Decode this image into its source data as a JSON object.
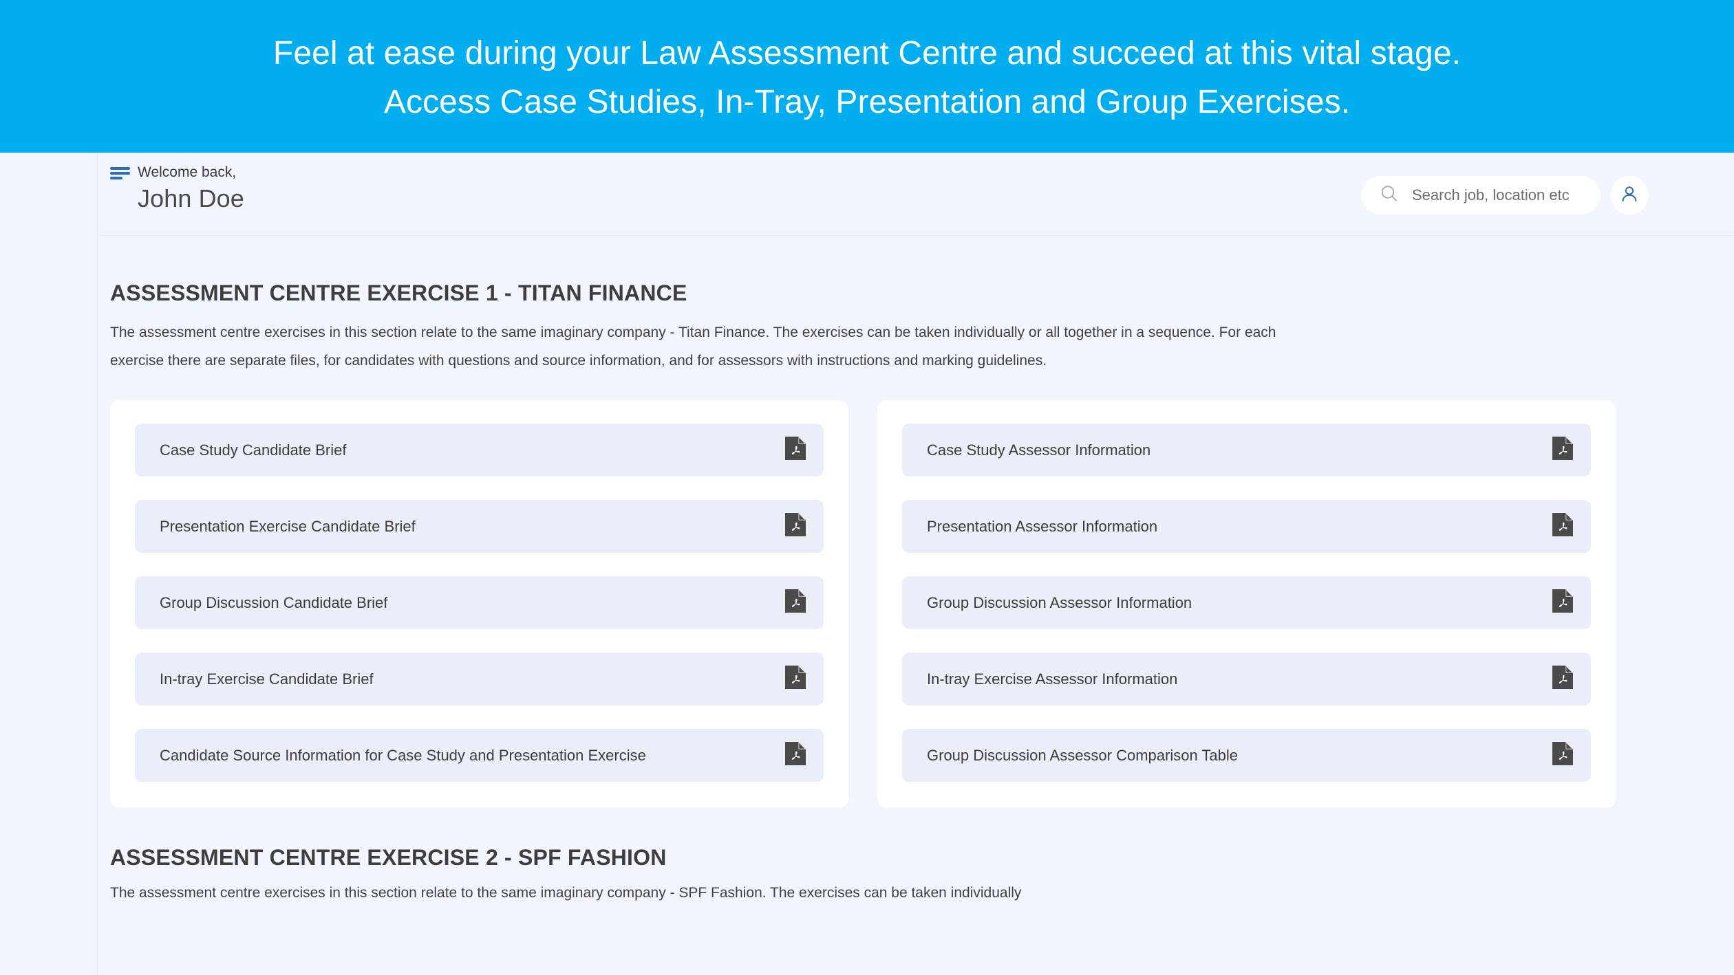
{
  "banner": {
    "line1": "Feel at ease during your Law Assessment Centre and succeed at this vital stage.",
    "line2": "Access Case Studies, In-Tray, Presentation and Group Exercises.",
    "background_color": "#00adef",
    "text_color": "#ffffff"
  },
  "header": {
    "menu_icon": "hamburger-icon",
    "welcome_label": "Welcome back,",
    "user_name": "John Doe",
    "search": {
      "icon": "search-icon",
      "placeholder": "Search job, location etc",
      "value": ""
    },
    "profile": {
      "icon": "user-icon"
    },
    "accent_color": "#2f6eb5"
  },
  "sections": [
    {
      "title": "ASSESSMENT CENTRE EXERCISE 1 - TITAN FINANCE",
      "description": "The assessment centre exercises in this section relate to the same imaginary company - Titan Finance. The exercises can be taken individually or all together in a sequence. For each exercise there are separate files, for candidates with questions and source information, and for assessors with instructions and marking guidelines.",
      "candidate_documents": [
        {
          "label": "Case Study Candidate Brief",
          "icon": "pdf-icon"
        },
        {
          "label": "Presentation Exercise Candidate Brief",
          "icon": "pdf-icon"
        },
        {
          "label": "Group Discussion Candidate Brief",
          "icon": "pdf-icon"
        },
        {
          "label": "In-tray Exercise Candidate Brief",
          "icon": "pdf-icon"
        },
        {
          "label": "Candidate Source Information for Case Study and Presentation Exercise",
          "icon": "pdf-icon"
        }
      ],
      "assessor_documents": [
        {
          "label": "Case Study Assessor Information",
          "icon": "pdf-icon"
        },
        {
          "label": "Presentation Assessor Information",
          "icon": "pdf-icon"
        },
        {
          "label": "Group Discussion Assessor Information",
          "icon": "pdf-icon"
        },
        {
          "label": "In-tray Exercise Assessor Information",
          "icon": "pdf-icon"
        },
        {
          "label": "Group Discussion Assessor Comparison Table",
          "icon": "pdf-icon"
        }
      ]
    },
    {
      "title": "ASSESSMENT CENTRE EXERCISE 2 - SPF FASHION",
      "description": "The assessment centre exercises in this section relate to the same imaginary company - SPF Fashion. The exercises can be taken individually"
    }
  ],
  "colors": {
    "page_background": "#f1f5fd",
    "card_background": "#ffffff",
    "doc_item_background": "#e9eef8",
    "pdf_icon": "#4a4a4a"
  }
}
